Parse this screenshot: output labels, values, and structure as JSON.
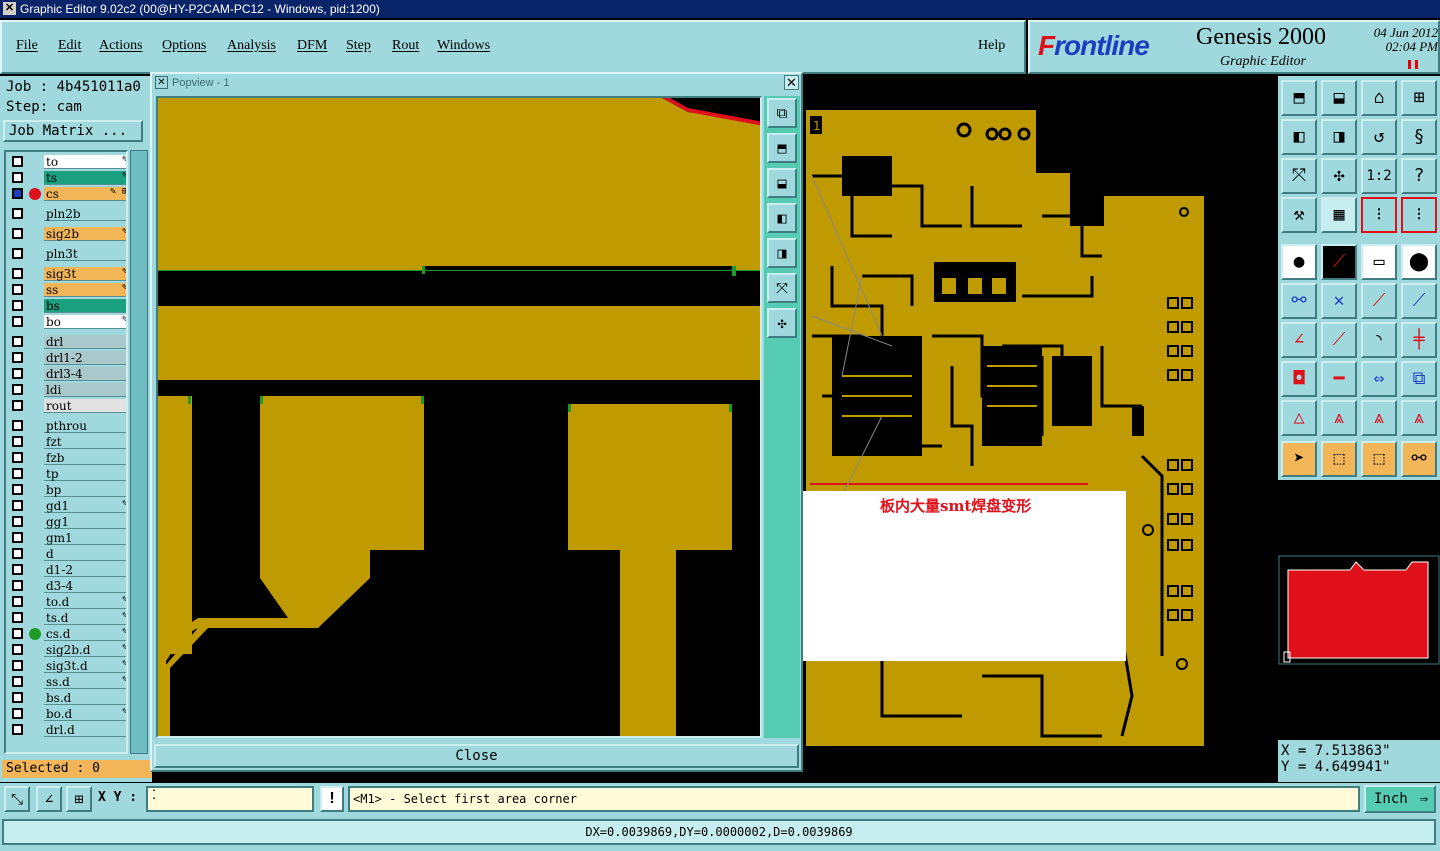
{
  "window": {
    "title": "Graphic Editor 9.02c2 (00@HY-P2CAM-PC12 - Windows, pid:1200)"
  },
  "menu": [
    "File",
    "Edit",
    "Actions",
    "Options",
    "Analysis",
    "DFM",
    "Step",
    "Rout",
    "Windows"
  ],
  "help_label": "Help",
  "brand": {
    "logo_f": "F",
    "logo_rest": "rontline",
    "product": "Genesis 2000",
    "subtitle": "Graphic Editor",
    "date": "04 Jun 2012",
    "time": "02:04 PM"
  },
  "job": {
    "label": "Job : 4b451011a0",
    "step": "Step: cam",
    "matrix_button": "Job Matrix ..."
  },
  "layers": [
    {
      "name": "to",
      "color": "#ffffff",
      "flag": "✎"
    },
    {
      "name": "ts",
      "color": "#1aa07f",
      "flag": "✎"
    },
    {
      "name": "cs",
      "color": "#f2b659",
      "flag": "✎ ⊞",
      "checked": true,
      "dot": "#e0101a"
    },
    {
      "name": "pln2b",
      "color": "#9fd9de",
      "flag": ""
    },
    {
      "name": "sig2b",
      "color": "#f2b659",
      "flag": "✎"
    },
    {
      "name": "pln3t",
      "color": "#9fd9de",
      "flag": ""
    },
    {
      "name": "sig3t",
      "color": "#f2b659",
      "flag": "✎"
    },
    {
      "name": "ss",
      "color": "#f2b659",
      "flag": "✎"
    },
    {
      "name": "bs",
      "color": "#1aa07f",
      "flag": ""
    },
    {
      "name": "bo",
      "color": "#ffffff",
      "flag": "✎"
    },
    {
      "name": "drl",
      "color": "#a9c8cc",
      "flag": ""
    },
    {
      "name": "drl1-2",
      "color": "#a9c8cc",
      "flag": ""
    },
    {
      "name": "drl3-4",
      "color": "#a9c8cc",
      "flag": ""
    },
    {
      "name": "ldi",
      "color": "#a9c8cc",
      "flag": ""
    },
    {
      "name": "rout",
      "color": "#e2e2e2",
      "flag": ""
    },
    {
      "name": "pthrou",
      "color": "#9fd9de",
      "flag": ""
    },
    {
      "name": "fzt",
      "color": "#9fd9de",
      "flag": ""
    },
    {
      "name": "fzb",
      "color": "#9fd9de",
      "flag": ""
    },
    {
      "name": "tp",
      "color": "#9fd9de",
      "flag": ""
    },
    {
      "name": "bp",
      "color": "#9fd9de",
      "flag": ""
    },
    {
      "name": "gd1",
      "color": "#9fd9de",
      "flag": "✎"
    },
    {
      "name": "gg1",
      "color": "#9fd9de",
      "flag": ""
    },
    {
      "name": "gm1",
      "color": "#9fd9de",
      "flag": ""
    },
    {
      "name": "d",
      "color": "#9fd9de",
      "flag": ""
    },
    {
      "name": "d1-2",
      "color": "#9fd9de",
      "flag": ""
    },
    {
      "name": "d3-4",
      "color": "#9fd9de",
      "flag": ""
    },
    {
      "name": "to.d",
      "color": "#9fd9de",
      "flag": "✎"
    },
    {
      "name": "ts.d",
      "color": "#9fd9de",
      "flag": "✎"
    },
    {
      "name": "cs.d",
      "color": "#9fd9de",
      "flag": "✎",
      "dot": "#1f9a2a"
    },
    {
      "name": "sig2b.d",
      "color": "#9fd9de",
      "flag": "✎"
    },
    {
      "name": "sig3t.d",
      "color": "#9fd9de",
      "flag": "✎"
    },
    {
      "name": "ss.d",
      "color": "#9fd9de",
      "flag": "✎"
    },
    {
      "name": "bs.d",
      "color": "#9fd9de",
      "flag": ""
    },
    {
      "name": "bo.d",
      "color": "#9fd9de",
      "flag": "✎"
    },
    {
      "name": "drl.d",
      "color": "#9fd9de",
      "flag": ""
    }
  ],
  "selected": "Selected : 0",
  "annotation": "板内大量smt焊盘变形",
  "board_marker": "1",
  "popview": {
    "title": "Popview - 1",
    "close_label": "Close"
  },
  "coords": {
    "x": "X = 7.513863\"",
    "y": "Y = 4.649941\""
  },
  "command": {
    "xy_label": "X Y :",
    "prompt": "<M1> - Select first area corner",
    "units": "Inch"
  },
  "status": "DX=0.0039869,DY=0.0000002,D=0.0039869",
  "colors": {
    "copper": "#bf9a00",
    "panel": "#9fd9de",
    "accent_red": "#e0101a"
  }
}
